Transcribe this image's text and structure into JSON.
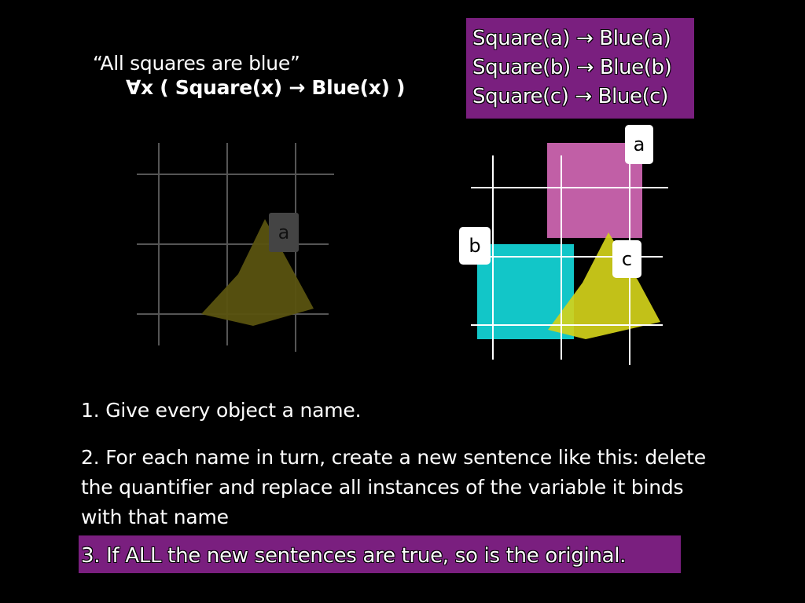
{
  "english_sentence": "“All squares are blue”",
  "fol_formula": "∀x ( Square(x) → Blue(x) )",
  "instances": [
    "Square(a) → Blue(a)",
    "Square(b) → Blue(b)",
    "Square(c) → Blue(c)"
  ],
  "left_world": {
    "objects": [
      {
        "name": "a",
        "shape": "triangle",
        "color": "#5a5310"
      }
    ]
  },
  "right_world": {
    "objects": [
      {
        "name": "a",
        "shape": "square",
        "color": "#c15fa6"
      },
      {
        "name": "b",
        "shape": "square",
        "color": "#12c6c8"
      },
      {
        "name": "c",
        "shape": "triangle",
        "color": "#d3d11a"
      }
    ]
  },
  "steps": [
    "1. Give every object a name.",
    "2. For each name in turn, create a new sentence like this: delete the quantifier and replace all instances of the variable it binds with that name",
    "3. If ALL the new sentences are true, so is the original."
  ],
  "colors": {
    "highlight": "#7a1f7f",
    "background": "#000000",
    "grid_dim": "#555555",
    "grid_bright": "#ffffff"
  }
}
